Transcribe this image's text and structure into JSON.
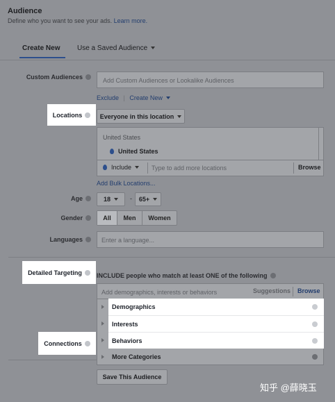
{
  "header": {
    "title": "Audience",
    "subtitle": "Define who you want to see your ads.",
    "learn_more": "Learn more."
  },
  "tabs": {
    "create_new": "Create New",
    "saved": "Use a Saved Audience"
  },
  "custom_audiences": {
    "label": "Custom Audiences",
    "placeholder": "Add Custom Audiences or Lookalike Audiences",
    "exclude": "Exclude",
    "create_new": "Create New"
  },
  "locations": {
    "label": "Locations",
    "dropdown": "Everyone in this location",
    "country_header": "United States",
    "selected": "United States",
    "include": "Include",
    "placeholder": "Type to add more locations",
    "browse": "Browse",
    "bulk": "Add Bulk Locations..."
  },
  "age": {
    "label": "Age",
    "min": "18",
    "dash": "-",
    "max": "65+"
  },
  "gender": {
    "label": "Gender",
    "options": [
      "All",
      "Men",
      "Women"
    ],
    "selected": "All"
  },
  "languages": {
    "label": "Languages",
    "placeholder": "Enter a language..."
  },
  "detailed_targeting": {
    "label": "Detailed Targeting",
    "include_text": "INCLUDE people who match at least ONE of the following",
    "placeholder": "Add demographics, interests or behaviors",
    "suggestions": "Suggestions",
    "browse": "Browse",
    "menu": [
      "Demographics",
      "Interests",
      "Behaviors",
      "More Categories"
    ]
  },
  "connections": {
    "label": "Connections"
  },
  "save_button": "Save This Audience",
  "watermark": "知乎 @薛晓玉"
}
